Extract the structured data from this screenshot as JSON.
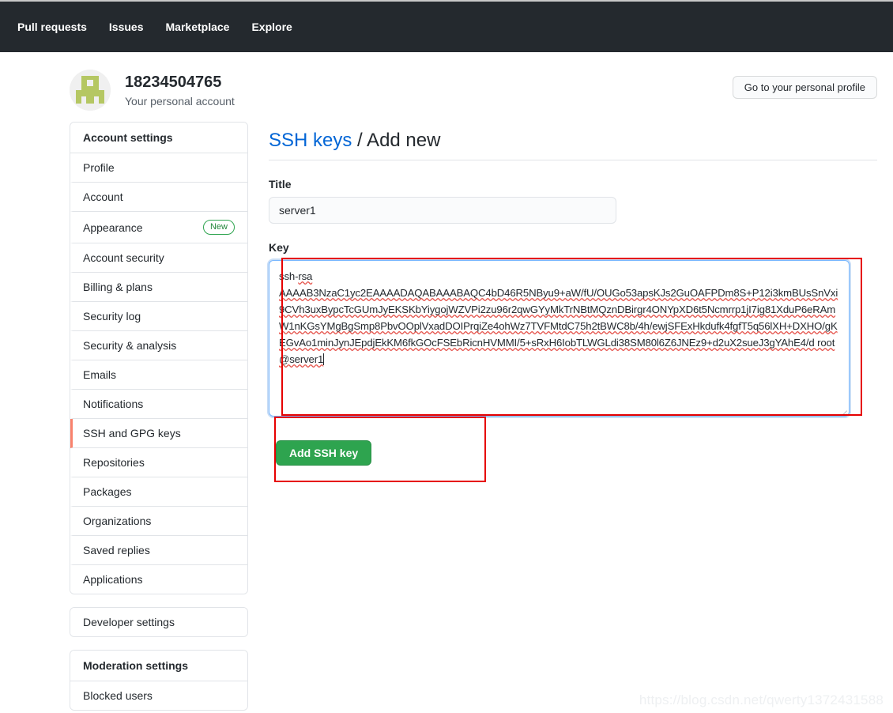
{
  "topnav": {
    "items": [
      {
        "label": "Pull requests"
      },
      {
        "label": "Issues"
      },
      {
        "label": "Marketplace"
      },
      {
        "label": "Explore"
      }
    ]
  },
  "account_header": {
    "name": "18234504765",
    "subtitle": "Your personal account",
    "profile_button": "Go to your personal profile",
    "avatar_icon": "identicon-avatar"
  },
  "sidebar": {
    "account_settings": {
      "heading": "Account settings",
      "items": [
        {
          "label": "Profile",
          "badge": "",
          "selected": false
        },
        {
          "label": "Account",
          "badge": "",
          "selected": false
        },
        {
          "label": "Appearance",
          "badge": "New",
          "selected": false
        },
        {
          "label": "Account security",
          "badge": "",
          "selected": false
        },
        {
          "label": "Billing & plans",
          "badge": "",
          "selected": false
        },
        {
          "label": "Security log",
          "badge": "",
          "selected": false
        },
        {
          "label": "Security & analysis",
          "badge": "",
          "selected": false
        },
        {
          "label": "Emails",
          "badge": "",
          "selected": false
        },
        {
          "label": "Notifications",
          "badge": "",
          "selected": false
        },
        {
          "label": "SSH and GPG keys",
          "badge": "",
          "selected": true
        },
        {
          "label": "Repositories",
          "badge": "",
          "selected": false
        },
        {
          "label": "Packages",
          "badge": "",
          "selected": false
        },
        {
          "label": "Organizations",
          "badge": "",
          "selected": false
        },
        {
          "label": "Saved replies",
          "badge": "",
          "selected": false
        },
        {
          "label": "Applications",
          "badge": "",
          "selected": false
        }
      ]
    },
    "developer_settings": {
      "label": "Developer settings"
    },
    "moderation_settings": {
      "heading": "Moderation settings",
      "items": [
        {
          "label": "Blocked users"
        }
      ]
    }
  },
  "main": {
    "title_link": "SSH keys",
    "title_rest": "/ Add new",
    "title_field": {
      "label": "Title",
      "value": "server1",
      "placeholder": ""
    },
    "key_field": {
      "label": "Key",
      "placeholder": "",
      "lines": [
        "ssh-rsa",
        "AAAAB3NzaC1yc2EAAAADAQABAAABAQC4bD46R5NByu9+aW/fU/OUGo53apsKJs2GuOAFPDm8S+P12i3kmBUsSnVxi9CVh3uxBypcTcGUmJyEKSKbYiygojWZVPi2zu96r2qwGYyMkTrNBtMQznDBirgr4ONYpXD6t5Ncmrrp1jI7ig81XduP6eRAmW1nKGsYMgBgSmp8PbvOOplVxadDOIPrqiZe4ohWz7TVFMtdC75h2tBWC8b/4h/ewjSFExHkdufk4fgfT5q56lXH+DXHO/gKEGvAo1minJynJEpdjEkKM6fkGOcFSEbRicnHVMMI/5+sRxH6IobTLWGLdi38SM80l6Z6JNEz9+d2uX2sueJ3gYAhE4/d root@server1"
      ]
    },
    "submit_button": "Add SSH key"
  },
  "annotations": {
    "color": "#e60000",
    "boxes": [
      {
        "name": "key-textarea-highlight"
      },
      {
        "name": "submit-button-highlight"
      }
    ]
  },
  "watermark": "https://blog.csdn.net/qwerty1372431588"
}
